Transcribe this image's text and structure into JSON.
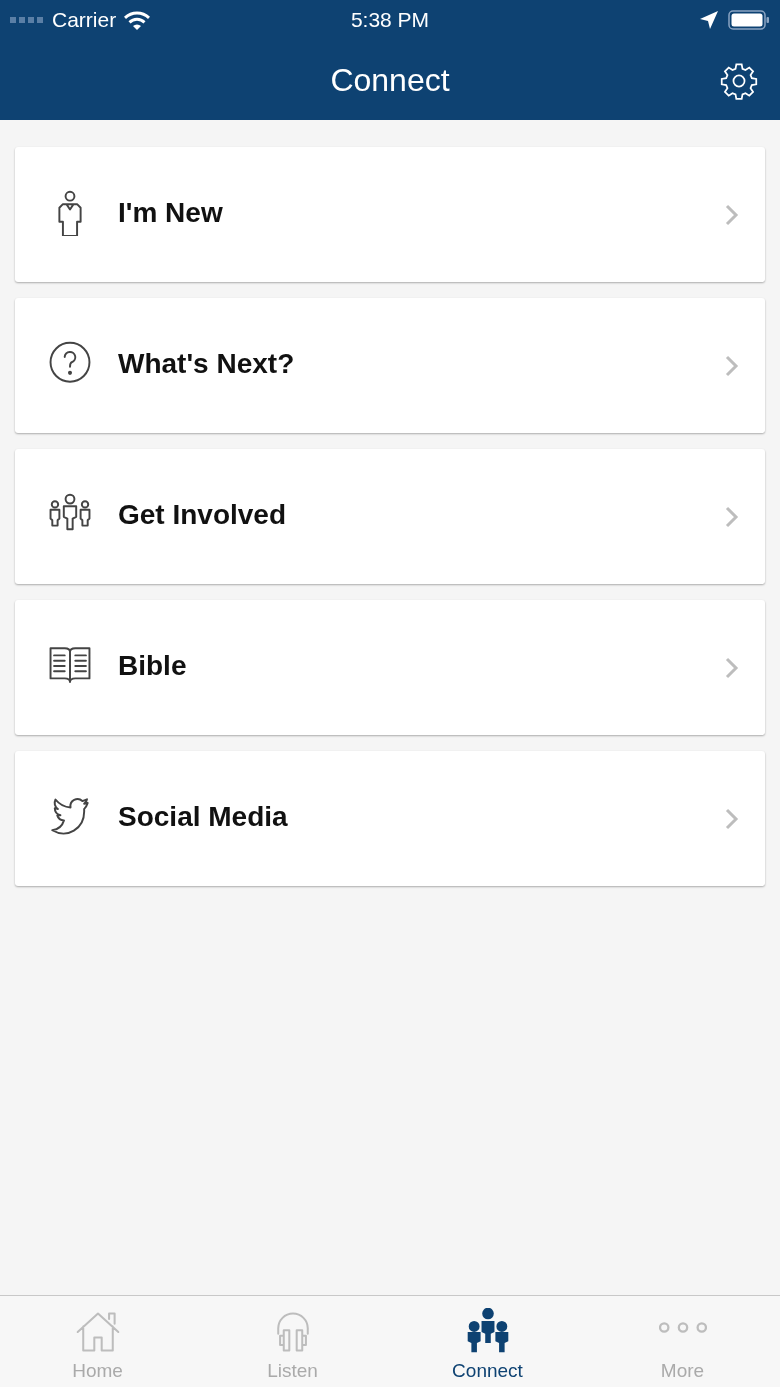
{
  "status_bar": {
    "carrier": "Carrier",
    "time": "5:38 PM"
  },
  "nav_bar": {
    "title": "Connect"
  },
  "items": [
    {
      "kind": "person",
      "label": "I'm New"
    },
    {
      "kind": "question",
      "label": "What's Next?"
    },
    {
      "kind": "group",
      "label": "Get Involved"
    },
    {
      "kind": "book",
      "label": "Bible"
    },
    {
      "kind": "bird",
      "label": "Social Media"
    }
  ],
  "tab_bar": [
    {
      "kind": "home",
      "label": "Home",
      "selected": false
    },
    {
      "kind": "headphones",
      "label": "Listen",
      "selected": false
    },
    {
      "kind": "group",
      "label": "Connect",
      "selected": true
    },
    {
      "kind": "more",
      "label": "More",
      "selected": false
    }
  ]
}
